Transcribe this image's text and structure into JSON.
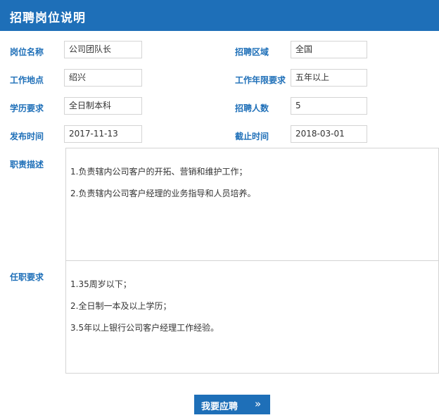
{
  "header": {
    "title": "招聘岗位说明"
  },
  "fields": {
    "position_name": {
      "label": "岗位名称",
      "value": "公司团队长"
    },
    "region": {
      "label": "招聘区域",
      "value": "全国"
    },
    "location": {
      "label": "工作地点",
      "value": "绍兴"
    },
    "experience": {
      "label": "工作年限要求",
      "value": "五年以上"
    },
    "education": {
      "label": "学历要求",
      "value": "全日制本科"
    },
    "headcount": {
      "label": "招聘人数",
      "value": "5"
    },
    "publish_date": {
      "label": "发布时间",
      "value": "2017-11-13"
    },
    "deadline": {
      "label": "截止时间",
      "value": "2018-03-01"
    }
  },
  "duties": {
    "label": "职责描述",
    "lines": [
      "1.负责辖内公司客户的开拓、营销和维护工作；",
      "2.负责辖内公司客户经理的业务指导和人员培养。"
    ]
  },
  "requirements": {
    "label": "任职要求",
    "lines": [
      "1.35周岁以下；",
      "2.全日制一本及以上学历；",
      "3.5年以上银行公司客户经理工作经验。"
    ]
  },
  "apply": {
    "label": "我要应聘",
    "icon": "double-chevron-right-icon",
    "glyph": "»"
  },
  "colors": {
    "accent": "#1e6fb8",
    "border": "#d4d4d4"
  }
}
